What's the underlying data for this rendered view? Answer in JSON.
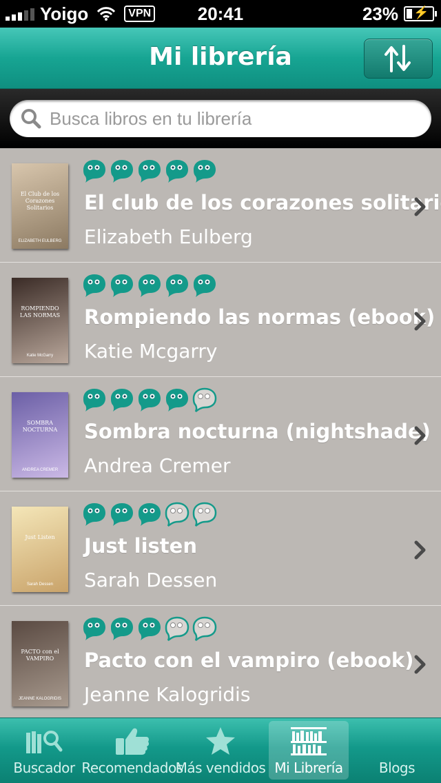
{
  "status_bar": {
    "carrier": "Yoigo",
    "vpn": "VPN",
    "time": "20:41",
    "battery_text": "23%",
    "battery_level": 0.23
  },
  "nav": {
    "title": "Mi librería",
    "sort_icon": "sort-arrows-icon"
  },
  "search": {
    "placeholder": "Busca libros en tu librería",
    "value": ""
  },
  "books": [
    {
      "title": "El club de los corazones solitarios",
      "author": "Elizabeth Eulberg",
      "rating": 5,
      "cover_title": "El Club de los Corazones Solitarios",
      "cover_author": "ELIZABETH EULBERG",
      "cover_colors": [
        "#d8c6ad",
        "#8c7a62"
      ]
    },
    {
      "title": "Rompiendo las normas (ebook)",
      "author": "Katie Mcgarry",
      "rating": 5,
      "cover_title": "ROMPIENDO LAS NORMAS",
      "cover_author": "Katie McGarry",
      "cover_colors": [
        "#3a2b26",
        "#b9a79b"
      ]
    },
    {
      "title": "Sombra nocturna (nightshade)",
      "author": "Andrea Cremer",
      "rating": 4,
      "cover_title": "SOMBRA NOCTURNA",
      "cover_author": "ANDREA CREMER",
      "cover_colors": [
        "#6b5fa6",
        "#cbb9e6"
      ]
    },
    {
      "title": "Just listen",
      "author": "Sarah Dessen",
      "rating": 3,
      "cover_title": "Just Listen",
      "cover_author": "Sarah Dessen",
      "cover_colors": [
        "#f4e6b8",
        "#c9a36a"
      ]
    },
    {
      "title": "Pacto con el vampiro (ebook)",
      "author": "Jeanne Kalogridis",
      "rating": 3,
      "cover_title": "PACTO con el VAMPIRO",
      "cover_author": "JEANNE KALOGRIDIS",
      "cover_colors": [
        "#5a4a42",
        "#a89a8e"
      ]
    }
  ],
  "tabs": [
    {
      "label": "Buscador",
      "icon": "search-books-icon",
      "active": false
    },
    {
      "label": "Recomendados",
      "icon": "thumbs-up-icon",
      "active": false
    },
    {
      "label": "Más vendidos",
      "icon": "star-icon",
      "active": false
    },
    {
      "label": "Mi Librería",
      "icon": "bookshelf-icon",
      "active": true
    },
    {
      "label": "Blogs",
      "icon": "blogs-icon",
      "active": false
    }
  ],
  "colors": {
    "accent": "#17a593",
    "rating_on": "#149a8a",
    "row_bg": "#bcb8b4"
  }
}
